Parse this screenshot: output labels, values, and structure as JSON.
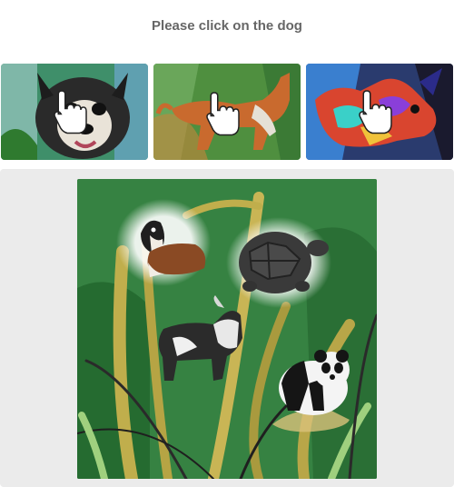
{
  "instruction": "Please click on the dog",
  "examples": [
    {
      "icon": "hand-pointer-icon",
      "subject": "dog-illustration"
    },
    {
      "icon": "hand-pointer-icon",
      "subject": "dog-illustration"
    },
    {
      "icon": "hand-pointer-icon",
      "subject": "dog-illustration"
    }
  ],
  "scene": {
    "icons": [
      "dog-icon",
      "turtle-icon",
      "cow-icon",
      "panda-icon"
    ],
    "colors": {
      "background": "#2f7a3c",
      "leaf": "#b9a64a",
      "stage": "#ebebeb"
    }
  }
}
